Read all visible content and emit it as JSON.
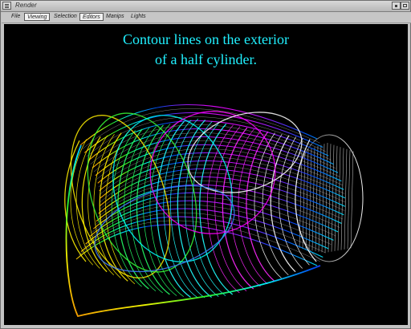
{
  "window": {
    "title": "Render"
  },
  "menu": {
    "items": [
      "File",
      "Viewing",
      "Selection",
      "Editors",
      "Manips",
      "Lights"
    ],
    "selected": [
      "Viewing",
      "Editors"
    ]
  },
  "scene": {
    "title_line_1": "Contour lines on the exterior",
    "title_line_2": "of a half cylinder.",
    "title_color": "#20f0ff",
    "background": "#000000",
    "object": "half-cylinder-wireframe",
    "colors": [
      "#ff8800",
      "#ffff00",
      "#33ff33",
      "#00ffff",
      "#0044ff",
      "#ff00ff",
      "#ffffff"
    ]
  }
}
